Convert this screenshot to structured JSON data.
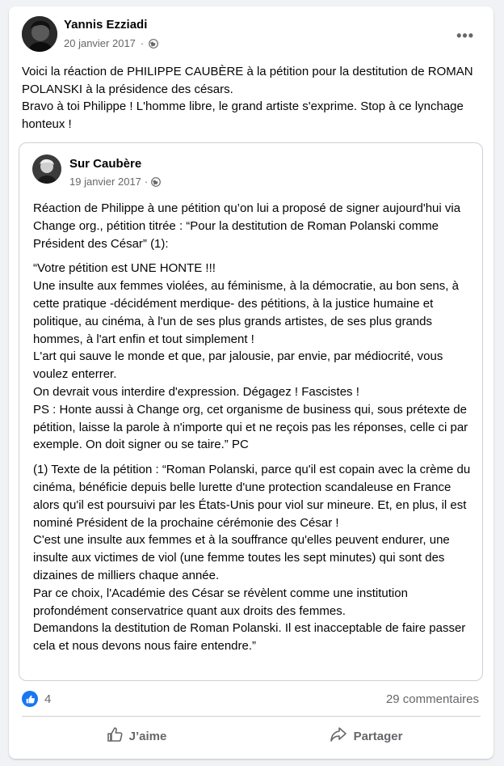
{
  "post": {
    "author": "Yannis Ezziadi",
    "date": "20 janvier 2017",
    "separator": "·",
    "more_label": "•••",
    "text_lines": [
      "Voici la réaction de PHILIPPE CAUBÈRE à la pétition pour la destitution de ROMAN POLANSKI à la présidence des césars.",
      "Bravo à toi Philippe ! L'homme libre, le grand artiste s'exprime. Stop à ce lynchage honteux !"
    ]
  },
  "shared": {
    "author": "Sur Caubère",
    "date": "19 janvier 2017",
    "separator": "·",
    "paragraphs": [
      "Réaction de Philippe à une pétition qu’on lui a proposé de signer aujourd'hui via Change org., pétition titrée : “Pour la destitution de Roman Polanski comme Président des César” (1):",
      "“Votre pétition est UNE HONTE !!!\nUne insulte aux femmes violées, au féminisme, à la démocratie, au bon sens, à cette pratique -décidément merdique- des pétitions,  à la justice humaine et politique, au cinéma, à l'un de ses plus grands artistes, de ses plus grands hommes, à l'art enfin et tout simplement !\nL'art qui sauve le monde et que, par jalousie, par envie, par médiocrité, vous voulez enterrer.\nOn devrait vous interdire d'expression. Dégagez ! Fascistes !\nPS : Honte aussi à Change org, cet organisme de business qui, sous prétexte de pétition, laisse la parole à n'importe qui et ne reçois pas les réponses, celle ci par exemple. On doit signer ou se taire.” PC",
      "(1) Texte de la pétition : “Roman Polanski, parce qu'il est copain avec la crème du cinéma, bénéficie depuis belle lurette d'une protection scandaleuse en France alors qu'il est poursuivi par les États-Unis pour viol sur mineure. Et, en plus, il est nominé Président de la prochaine cérémonie des César !\nC'est une insulte aux femmes et à la souffrance qu'elles peuvent endurer, une insulte aux victimes de viol (une femme toutes les sept minutes) qui sont des dizaines de milliers chaque année.\nPar ce choix, l'Académie des César se révèlent comme une institution profondément conservatrice quant aux droits des femmes.\nDemandons la destitution de Roman Polanski. Il est inacceptable de faire passer cela et nous devons nous faire entendre.”"
    ]
  },
  "stats": {
    "likes": "4",
    "comments": "29 commentaires"
  },
  "actions": {
    "like_label": "J’aime",
    "share_label": "Partager"
  },
  "colors": {
    "accent": "#1877f2",
    "secondary_text": "#65676b",
    "background": "#f0f2f5"
  },
  "icons": [
    "globe-icon",
    "more-icon",
    "like-reaction-icon",
    "thumbs-up-icon",
    "share-arrow-icon"
  ]
}
